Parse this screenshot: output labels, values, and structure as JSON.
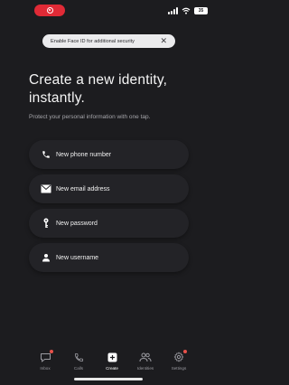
{
  "status_bar": {
    "battery": "35"
  },
  "banner": {
    "text": "Enable Face ID for additional security",
    "close": "✕"
  },
  "hero": {
    "title": "Create a new identity, instantly.",
    "subtitle": "Protect your personal information with one tap."
  },
  "options": [
    {
      "label": "New phone number",
      "icon": "phone-icon"
    },
    {
      "label": "New email address",
      "icon": "envelope-icon"
    },
    {
      "label": "New password",
      "icon": "key-icon"
    },
    {
      "label": "New username",
      "icon": "person-icon"
    }
  ],
  "tabbar": {
    "tabs": [
      {
        "label": "Inbox",
        "icon": "inbox-icon",
        "badge": true
      },
      {
        "label": "Calls",
        "icon": "phone-icon",
        "badge": false
      },
      {
        "label": "Create",
        "icon": "plus-icon",
        "badge": false,
        "active": true
      },
      {
        "label": "Identities",
        "icon": "people-icon",
        "badge": false
      },
      {
        "label": "Settings",
        "icon": "gear-icon",
        "badge": true
      }
    ]
  },
  "colors": {
    "background": "#1c1c1f",
    "card": "#232327",
    "accent_red": "#e02a36",
    "badge": "#e8514a"
  }
}
